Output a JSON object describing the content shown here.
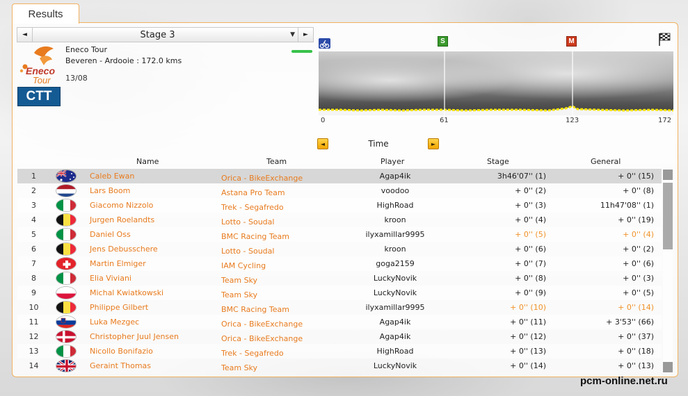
{
  "tab": {
    "label": "Results"
  },
  "stage_selector": {
    "label": "Stage 3",
    "left_arrow": "◄",
    "right_arrow": "►",
    "dropdown": "▼"
  },
  "race": {
    "logo_line1": "Eneco",
    "logo_line2": "Tour",
    "name": "Eneco Tour",
    "route": "Beveren - Ardooie : 172.0 kms",
    "date": "13/08",
    "stage_type": "CTT"
  },
  "profile": {
    "markers": {
      "sprint": "S",
      "mountain": "M"
    },
    "km_ticks": [
      "0",
      "61",
      "123",
      "172"
    ],
    "icons": {
      "start": "cyclist-icon",
      "finish": "checkered-flag-icon"
    }
  },
  "time_nav": {
    "label": "Time",
    "prev": "◄",
    "next": "►"
  },
  "columns": {
    "name": "Name",
    "team": "Team",
    "player": "Player",
    "stage": "Stage",
    "general": "General"
  },
  "rows": [
    {
      "pos": "1",
      "flag": "australia",
      "name": "Caleb Ewan",
      "team": "Orica - BikeExchange",
      "player": "Agap4ik",
      "stage": "3h46'07'' (1)",
      "general": "+ 0'' (15)"
    },
    {
      "pos": "2",
      "flag": "netherlands",
      "name": "Lars Boom",
      "team": "Astana Pro Team",
      "player": "voodoo",
      "stage": "+ 0'' (2)",
      "general": "+ 0'' (8)"
    },
    {
      "pos": "3",
      "flag": "italy",
      "name": "Giacomo Nizzolo",
      "team": "Trek - Segafredo",
      "player": "HighRoad",
      "stage": "+ 0'' (3)",
      "general": "11h47'08'' (1)"
    },
    {
      "pos": "4",
      "flag": "belgium",
      "name": "Jurgen Roelandts",
      "team": "Lotto - Soudal",
      "player": "kroon",
      "stage": "+ 0'' (4)",
      "general": "+ 0'' (19)"
    },
    {
      "pos": "5",
      "flag": "italy",
      "name": "Daniel Oss",
      "team": "BMC Racing Team",
      "player": "ilyxamillar9995",
      "stage": "+ 0'' (5)",
      "general": "+ 0'' (4)",
      "highlight": true
    },
    {
      "pos": "6",
      "flag": "belgium",
      "name": "Jens Debusschere",
      "team": "Lotto - Soudal",
      "player": "kroon",
      "stage": "+ 0'' (6)",
      "general": "+ 0'' (2)"
    },
    {
      "pos": "7",
      "flag": "switzerland",
      "name": "Martin Elmiger",
      "team": "IAM Cycling",
      "player": "goga2159",
      "stage": "+ 0'' (7)",
      "general": "+ 0'' (6)"
    },
    {
      "pos": "8",
      "flag": "italy",
      "name": "Elia Viviani",
      "team": "Team Sky",
      "player": "LuckyNovik",
      "stage": "+ 0'' (8)",
      "general": "+ 0'' (3)"
    },
    {
      "pos": "9",
      "flag": "poland",
      "name": "Michal Kwiatkowski",
      "team": "Team Sky",
      "player": "LuckyNovik",
      "stage": "+ 0'' (9)",
      "general": "+ 0'' (5)"
    },
    {
      "pos": "10",
      "flag": "belgium",
      "name": "Philippe Gilbert",
      "team": "BMC Racing Team",
      "player": "ilyxamillar9995",
      "stage": "+ 0'' (10)",
      "general": "+ 0'' (14)",
      "highlight": true
    },
    {
      "pos": "11",
      "flag": "slovenia",
      "name": "Luka  Mezgec",
      "team": "Orica - BikeExchange",
      "player": "Agap4ik",
      "stage": "+ 0'' (11)",
      "general": "+ 3'53'' (66)"
    },
    {
      "pos": "12",
      "flag": "denmark",
      "name": "Christopher Juul Jensen",
      "team": "Orica - BikeExchange",
      "player": "Agap4ik",
      "stage": "+ 0'' (12)",
      "general": "+ 0'' (37)"
    },
    {
      "pos": "13",
      "flag": "italy",
      "name": "Nicollo Bonifazio",
      "team": "Trek - Segafredo",
      "player": "HighRoad",
      "stage": "+ 0'' (13)",
      "general": "+ 0'' (18)"
    },
    {
      "pos": "14",
      "flag": "uk",
      "name": "Geraint Thomas",
      "team": "Team Sky",
      "player": "LuckyNovik",
      "stage": "+ 0'' (14)",
      "general": "+ 0'' (13)"
    }
  ],
  "colors": {
    "accent": "#e87b1e",
    "highlight": "#f0922a",
    "border": "#f0b060",
    "ctt_bg": "#145a93"
  },
  "watermark": "pcm-online.net.ru"
}
